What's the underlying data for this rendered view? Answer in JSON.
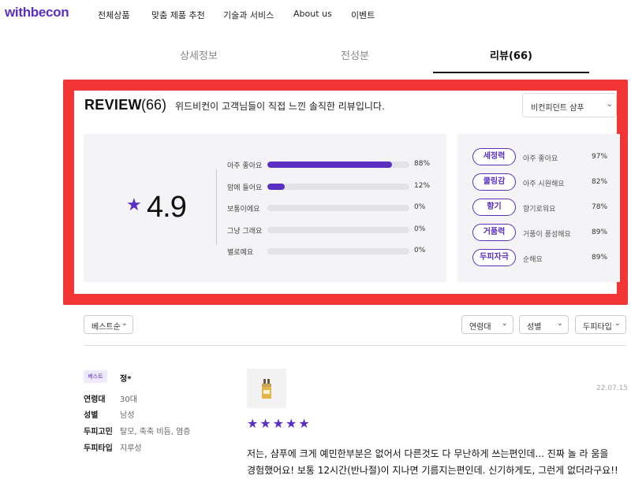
{
  "brand": {
    "logo": "withbecon",
    "accent_color": "#5a2fc2"
  },
  "nav": {
    "items": [
      "전체상품",
      "맞춤 제품 추천",
      "기술과 서비스",
      "About us",
      "이벤트"
    ]
  },
  "tabs": [
    {
      "label": "상세정보",
      "active": false
    },
    {
      "label": "전성분",
      "active": false
    },
    {
      "label": "리뷰(66)",
      "active": true
    }
  ],
  "highlight_color": "#f23535",
  "review_header": {
    "title": "REVIEW",
    "count": "(66)",
    "description": "위드비컨이 고객님들이 직접 느낀 솔직한 리뷰입니다.",
    "product_select": "비컨피던트 샴푸",
    "chevron_icon": "chevron-down-icon"
  },
  "rating": {
    "star_icon": "star-icon",
    "score": "4.9",
    "distribution": [
      {
        "label": "아주 좋아요",
        "percent": 88,
        "text": "88%"
      },
      {
        "label": "맘에 들어요",
        "percent": 12,
        "text": "12%"
      },
      {
        "label": "보통이에요",
        "percent": 0,
        "text": "0%"
      },
      {
        "label": "그냥 그래요",
        "percent": 0,
        "text": "0%"
      },
      {
        "label": "별로예요",
        "percent": 0,
        "text": "0%"
      }
    ]
  },
  "attributes": [
    {
      "badge": "세정력",
      "desc": "아주 좋아요",
      "pct": "97%"
    },
    {
      "badge": "쿨링감",
      "desc": "아주 시원해요",
      "pct": "82%"
    },
    {
      "badge": "향기",
      "desc": "향기로워요",
      "pct": "78%"
    },
    {
      "badge": "거품력",
      "desc": "거품이 풍성해요",
      "pct": "89%"
    },
    {
      "badge": "두피자극",
      "desc": "순해요",
      "pct": "89%"
    }
  ],
  "filters": {
    "sort": "베스트순",
    "age": "연령대",
    "gender": "성별",
    "scalp": "두피타입"
  },
  "review": {
    "best_badge": "베스트",
    "reviewer": "정*",
    "meta": [
      {
        "key": "연령대",
        "value": "30대"
      },
      {
        "key": "성별",
        "value": "남성"
      },
      {
        "key": "두피고민",
        "value": "탈모, 축축 비듬, 염증"
      },
      {
        "key": "두피타입",
        "value": "지루성"
      }
    ],
    "thumbnail_icon": "product-bottle-icon",
    "date": "22.07.15",
    "stars": "★★★★★",
    "rating_value": 5,
    "text": "저는, 샴푸에 크게 예민한부분은 없어서 다른것도 다 무난하게 쓰는편인데... 진짜 놀 라 움을 경험했어요! 보통 12시간(반나절)이 지나면 기름지는편인데. 신기하게도, 그런게 없더라구요!! 너무 놀라웠"
  }
}
